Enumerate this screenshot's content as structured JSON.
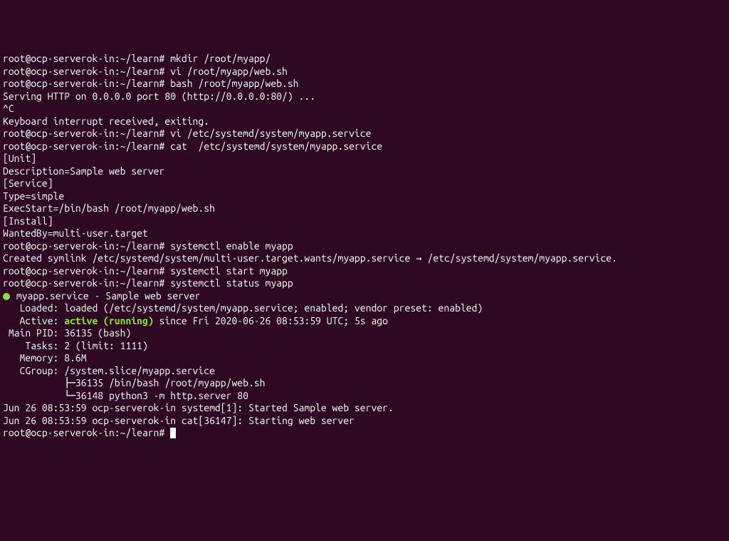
{
  "terminal": {
    "lines": [
      {
        "segments": [
          {
            "text": "root@ocp-serverok-in:~/learn# ",
            "class": "prompt"
          },
          {
            "text": "mkdir /root/myapp/",
            "class": "white"
          }
        ]
      },
      {
        "segments": [
          {
            "text": "root@ocp-serverok-in:~/learn# ",
            "class": "prompt"
          },
          {
            "text": "vi /root/myapp/web.sh",
            "class": "white"
          }
        ]
      },
      {
        "segments": [
          {
            "text": "root@ocp-serverok-in:~/learn# ",
            "class": "prompt"
          },
          {
            "text": "bash /root/myapp/web.sh",
            "class": "white"
          }
        ]
      },
      {
        "segments": [
          {
            "text": "Serving HTTP on 0.0.0.0 port 80 (http://0.0.0.0:80/) ...",
            "class": "white"
          }
        ]
      },
      {
        "segments": [
          {
            "text": "^C",
            "class": "white"
          }
        ]
      },
      {
        "segments": [
          {
            "text": "Keyboard interrupt received, exiting.",
            "class": "white"
          }
        ]
      },
      {
        "segments": [
          {
            "text": "root@ocp-serverok-in:~/learn# ",
            "class": "prompt"
          },
          {
            "text": "vi /etc/systemd/system/myapp.service",
            "class": "white"
          }
        ]
      },
      {
        "segments": [
          {
            "text": "root@ocp-serverok-in:~/learn# ",
            "class": "prompt"
          },
          {
            "text": "cat  /etc/systemd/system/myapp.service",
            "class": "white"
          }
        ]
      },
      {
        "segments": [
          {
            "text": "[Unit]",
            "class": "white"
          }
        ]
      },
      {
        "segments": [
          {
            "text": "Description=Sample web server",
            "class": "white"
          }
        ]
      },
      {
        "segments": [
          {
            "text": "",
            "class": "white"
          }
        ]
      },
      {
        "segments": [
          {
            "text": "[Service]",
            "class": "white"
          }
        ]
      },
      {
        "segments": [
          {
            "text": "Type=simple",
            "class": "white"
          }
        ]
      },
      {
        "segments": [
          {
            "text": "ExecStart=/bin/bash /root/myapp/web.sh",
            "class": "white"
          }
        ]
      },
      {
        "segments": [
          {
            "text": "",
            "class": "white"
          }
        ]
      },
      {
        "segments": [
          {
            "text": "[Install]",
            "class": "white"
          }
        ]
      },
      {
        "segments": [
          {
            "text": "WantedBy=multi-user.target",
            "class": "white"
          }
        ]
      },
      {
        "segments": [
          {
            "text": "root@ocp-serverok-in:~/learn# ",
            "class": "prompt"
          },
          {
            "text": "systemctl enable myapp",
            "class": "white"
          }
        ]
      },
      {
        "segments": [
          {
            "text": "Created symlink /etc/systemd/system/multi-user.target.wants/myapp.service → /etc/systemd/system/myapp.service.",
            "class": "white"
          }
        ]
      },
      {
        "segments": [
          {
            "text": "root@ocp-serverok-in:~/learn# ",
            "class": "prompt"
          },
          {
            "text": "systemctl start myapp",
            "class": "white"
          }
        ]
      },
      {
        "segments": [
          {
            "text": "root@ocp-serverok-in:~/learn# ",
            "class": "prompt"
          },
          {
            "text": "systemctl status myapp",
            "class": "white"
          }
        ]
      },
      {
        "segments": [
          {
            "dot": true
          },
          {
            "text": " myapp.service - Sample web server",
            "class": "white"
          }
        ]
      },
      {
        "segments": [
          {
            "text": "   Loaded: loaded (/etc/systemd/system/myapp.service; enabled; vendor preset: enabled)",
            "class": "white"
          }
        ]
      },
      {
        "segments": [
          {
            "text": "   Active: ",
            "class": "white"
          },
          {
            "text": "active (running)",
            "class": "green-bold"
          },
          {
            "text": " since Fri 2020-06-26 08:53:59 UTC; 5s ago",
            "class": "white"
          }
        ]
      },
      {
        "segments": [
          {
            "text": " Main PID: 36135 (bash)",
            "class": "white"
          }
        ]
      },
      {
        "segments": [
          {
            "text": "    Tasks: 2 (limit: 1111)",
            "class": "white"
          }
        ]
      },
      {
        "segments": [
          {
            "text": "   Memory: 8.6M",
            "class": "white"
          }
        ]
      },
      {
        "segments": [
          {
            "text": "   CGroup: /system.slice/myapp.service",
            "class": "white"
          }
        ]
      },
      {
        "segments": [
          {
            "text": "           ├─36135 /bin/bash /root/myapp/web.sh",
            "class": "white"
          }
        ]
      },
      {
        "segments": [
          {
            "text": "           └─36148 python3 -m http.server 80",
            "class": "white"
          }
        ]
      },
      {
        "segments": [
          {
            "text": "",
            "class": "white"
          }
        ]
      },
      {
        "segments": [
          {
            "text": "Jun 26 08:53:59 ocp-serverok-in systemd[1]: Started Sample web server.",
            "class": "white"
          }
        ]
      },
      {
        "segments": [
          {
            "text": "Jun 26 08:53:59 ocp-serverok-in cat[36147]: Starting web server",
            "class": "white"
          }
        ]
      },
      {
        "segments": [
          {
            "text": "root@ocp-serverok-in:~/learn# ",
            "class": "prompt"
          },
          {
            "cursor": true
          }
        ]
      }
    ]
  }
}
